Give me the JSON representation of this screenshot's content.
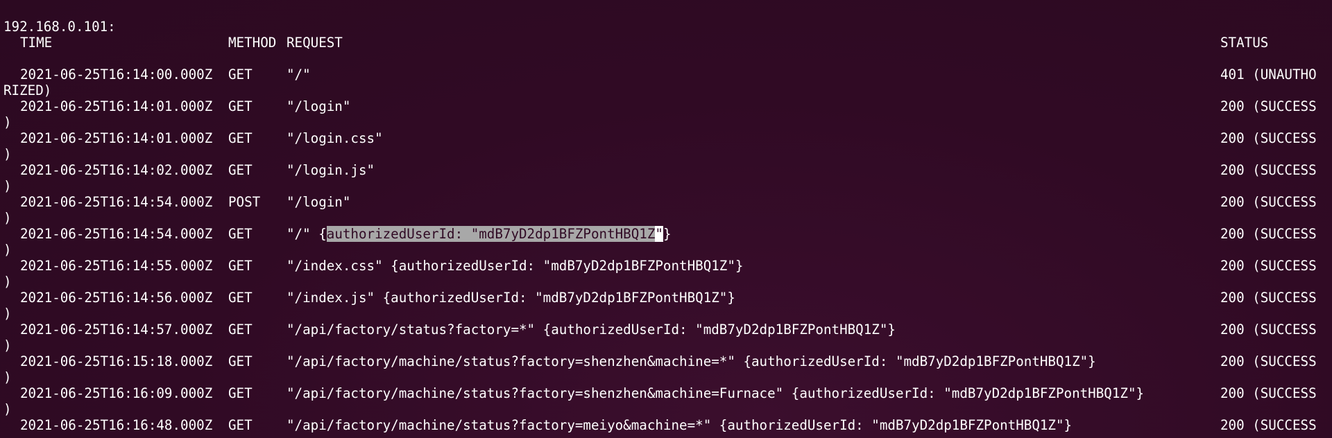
{
  "host": "192.168.0.101:",
  "headers": {
    "time": "TIME",
    "method": "METHOD",
    "request": "REQUEST",
    "status": "STATUS"
  },
  "rows": [
    {
      "time": "2021-06-25T16:14:00.000Z",
      "method": "GET",
      "request": "\"/\"",
      "status": "401 (UNAUTHO",
      "wrap": "RIZED)"
    },
    {
      "time": "2021-06-25T16:14:01.000Z",
      "method": "GET",
      "request": "\"/login\"",
      "status": "200 (SUCCESS",
      "wrap": ")"
    },
    {
      "time": "2021-06-25T16:14:01.000Z",
      "method": "GET",
      "request": "\"/login.css\"",
      "status": "200 (SUCCESS",
      "wrap": ")"
    },
    {
      "time": "2021-06-25T16:14:02.000Z",
      "method": "GET",
      "request": "\"/login.js\"",
      "status": "200 (SUCCESS",
      "wrap": ")"
    },
    {
      "time": "2021-06-25T16:14:54.000Z",
      "method": "POST",
      "request": "\"/login\"",
      "status": "200 (SUCCESS",
      "wrap": ")"
    },
    {
      "time": "2021-06-25T16:14:54.000Z",
      "method": "GET",
      "request_prefix": "\"/\" {",
      "request_selected": "authorizedUserId: \"mdB7yD2dp1BFZPontHBQ1Z",
      "request_cursor": "\"",
      "request_suffix": "}",
      "status": "200 (SUCCESS",
      "wrap": ")"
    },
    {
      "time": "2021-06-25T16:14:55.000Z",
      "method": "GET",
      "request": "\"/index.css\" {authorizedUserId: \"mdB7yD2dp1BFZPontHBQ1Z\"}",
      "status": "200 (SUCCESS",
      "wrap": ")"
    },
    {
      "time": "2021-06-25T16:14:56.000Z",
      "method": "GET",
      "request": "\"/index.js\" {authorizedUserId: \"mdB7yD2dp1BFZPontHBQ1Z\"}",
      "status": "200 (SUCCESS",
      "wrap": ")"
    },
    {
      "time": "2021-06-25T16:14:57.000Z",
      "method": "GET",
      "request": "\"/api/factory/status?factory=*\" {authorizedUserId: \"mdB7yD2dp1BFZPontHBQ1Z\"}",
      "status": "200 (SUCCESS",
      "wrap": ")"
    },
    {
      "time": "2021-06-25T16:15:18.000Z",
      "method": "GET",
      "request": "\"/api/factory/machine/status?factory=shenzhen&machine=*\" {authorizedUserId: \"mdB7yD2dp1BFZPontHBQ1Z\"}",
      "status": "200 (SUCCESS",
      "wrap": ")"
    },
    {
      "time": "2021-06-25T16:16:09.000Z",
      "method": "GET",
      "request": "\"/api/factory/machine/status?factory=shenzhen&machine=Furnace\" {authorizedUserId: \"mdB7yD2dp1BFZPontHBQ1Z\"}",
      "status": "200 (SUCCESS",
      "wrap": ")"
    },
    {
      "time": "2021-06-25T16:16:48.000Z",
      "method": "GET",
      "request": "\"/api/factory/machine/status?factory=meiyo&machine=*\" {authorizedUserId: \"mdB7yD2dp1BFZPontHBQ1Z\"}",
      "status": "200 (SUCCESS",
      "wrap": ""
    }
  ],
  "colors": {
    "background": "#300a24",
    "foreground": "#ffffff",
    "selection": "#a8a8a8"
  }
}
